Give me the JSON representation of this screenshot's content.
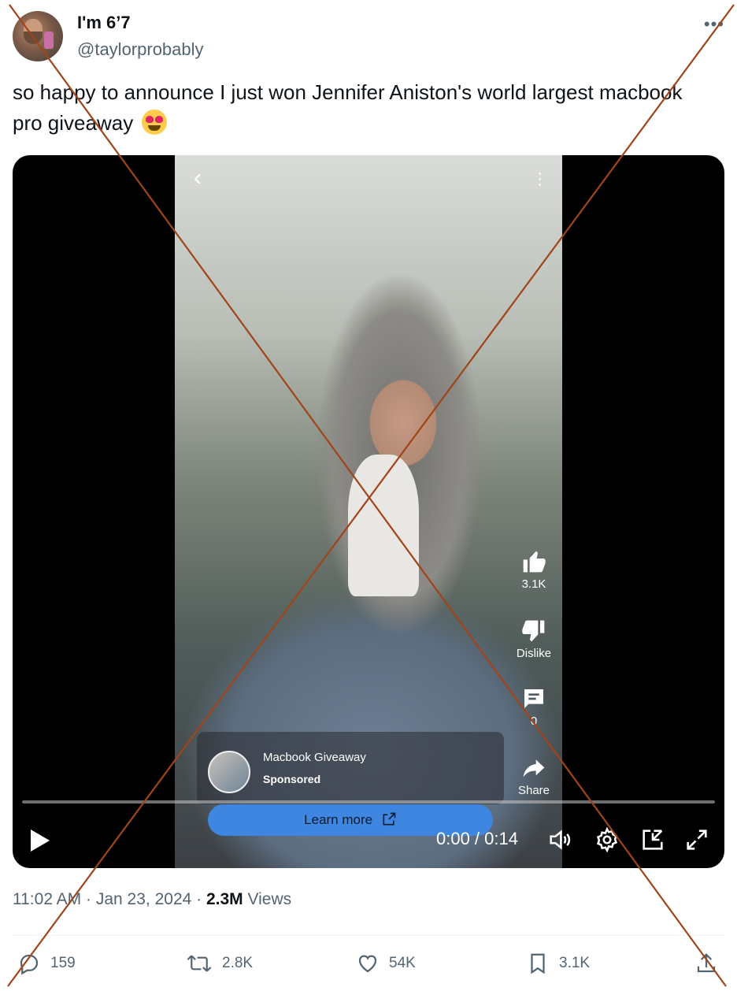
{
  "author": {
    "display_name": "I'm 6’7",
    "handle": "@taylorprobably"
  },
  "tweet": {
    "text": "so happy to announce I just won Jennifer Aniston's world largest macbook pro giveaway",
    "emoji": "smiling-face-with-heart-eyes"
  },
  "video": {
    "actions": {
      "like_count": "3.1K",
      "dislike_label": "Dislike",
      "comment_count": "0",
      "share_label": "Share"
    },
    "ad": {
      "title": "Macbook Giveaway",
      "sponsored": "Sponsored",
      "button_label": "Learn more"
    },
    "time_display": "0:00 / 0:14",
    "progress": 0
  },
  "meta": {
    "time": "11:02 AM",
    "separator": "·",
    "date": "Jan 23, 2024",
    "views_count": "2.3M",
    "views_label": "Views"
  },
  "engagement": {
    "replies": "159",
    "retweets": "2.8K",
    "likes": "54K",
    "bookmarks": "3.1K"
  },
  "overlay": {
    "cross_color": "#a0441a",
    "link_color": "#1d9bf0"
  }
}
